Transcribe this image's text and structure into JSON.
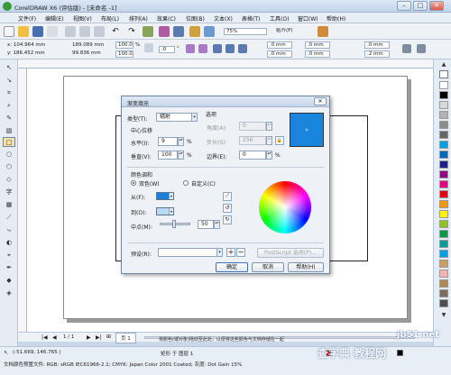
{
  "window": {
    "title": "CorelDRAW X6 (评估版) - [未命名 -1]",
    "minimize": "–",
    "maximize": "□",
    "close": "✕"
  },
  "menu": [
    "文件(F)",
    "编辑(E)",
    "视图(V)",
    "布局(L)",
    "排列(A)",
    "效果(C)",
    "位图(B)",
    "文本(X)",
    "表格(T)",
    "工具(O)",
    "窗口(W)",
    "帮助(H)"
  ],
  "toolbar1": {
    "zoom": "75%",
    "snap": "贴齐(P)"
  },
  "toolbar2": {
    "x": "x: 104.964 mm",
    "y": "y: 186.452 mm",
    "w": "189.089 mm",
    "h": "99.836 mm",
    "scale_w": "100.0",
    "scale_h": "100.0",
    "pct": "%",
    "angle": ".0",
    "deg": "°",
    "corner1": ".0 mm",
    "corner2": ".0 mm",
    "corner3": ".0 mm",
    "corner4": ".0 mm",
    "outline1": ".0 mm",
    "outline2": ".2 mm"
  },
  "pagebar": {
    "pages": "1 / 1",
    "tab": "页 1"
  },
  "status": {
    "coords": "(-51.669, 146.765 )",
    "object": "矩形 于 图层 1",
    "hint": "将颜色(或对象)拖动至此处，以便将这些颜色与文档存储在一起",
    "profile": "文档颜色预置文件: RGB: sRGB IEC61966-2.1; CMYK: Japan Color 2001 Coated; 灰度: Dot Gain 15%"
  },
  "dialog": {
    "title": "渐变填充",
    "close": "✕",
    "type_label": "类型(T):",
    "type_value": "辐射",
    "options_label": "选项",
    "center_label": "中心位移",
    "horiz_label": "水平(I):",
    "horiz_value": "9",
    "vert_label": "垂直(V):",
    "vert_value": "100",
    "angle_label": "角度(A):",
    "angle_value": "0",
    "steps_label": "步长(S):",
    "steps_value": "256",
    "edge_label": "边界(E):",
    "edge_value": "0",
    "pct": "%",
    "blend_label": "颜色调和",
    "two_color": "双色(W)",
    "custom": "自定义(C)",
    "from_label": "从(F):",
    "to_label": "到(O):",
    "mid_label": "中点(M):",
    "mid_value": "50",
    "preset_label": "预设(R):",
    "preset_value": "",
    "postscript": "PostScript 选项(P)...",
    "ok": "确定",
    "cancel": "取消",
    "help": "帮助(H)",
    "from_color": "#1a7fd6",
    "to_color": "#b9d9f6",
    "preview_color": "#1a85dc"
  },
  "palette": [
    "#ffffff",
    "#000000",
    "#d9d9d9",
    "#b3b3b3",
    "#8c8c8c",
    "#666666",
    "#00a0e9",
    "#0068b7",
    "#1d2088",
    "#920783",
    "#e4007f",
    "#e60012",
    "#f39800",
    "#fff100",
    "#8fc31f",
    "#009944",
    "#009e96",
    "#00a0e9",
    "#c9a063",
    "#f5b2b2",
    "#b28850",
    "#7d6b5d",
    "#4d4d4d"
  ],
  "watermark": {
    "line1": "查字典 教程网",
    "line2": "jb51.net"
  }
}
